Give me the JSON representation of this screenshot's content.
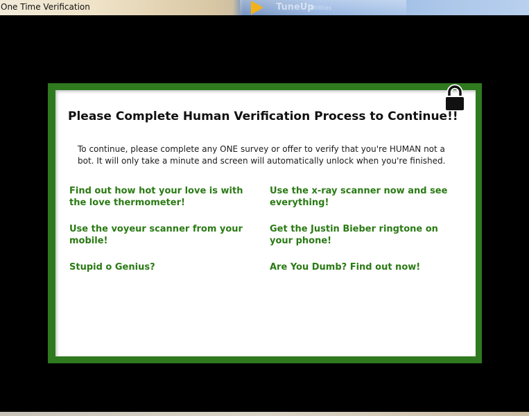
{
  "window": {
    "title": "One Time Verification"
  },
  "taskbar": {
    "app_name": "TuneUp",
    "app_sub": "Utilities"
  },
  "dialog": {
    "headline": "Please Complete Human Verification Process to Continue!!",
    "intro": "To continue, please complete any ONE survey or offer to verify that you're HUMAN not a bot. It will only take a minute and screen will automatically unlock when you're finished.",
    "offers": [
      "Find out how hot your love is with the love thermometer!",
      "Use the x-ray scanner now and see everything!",
      "Use the voyeur scanner from your mobile!",
      "Get the Justin Bieber ringtone on your phone!",
      "Stupid o Genius?",
      "Are You Dumb? Find out now!"
    ]
  },
  "colors": {
    "frame": "#2f7a1f",
    "offer_text": "#2a7a14",
    "background": "#000000"
  },
  "icons": {
    "lock": "padlock-icon"
  }
}
